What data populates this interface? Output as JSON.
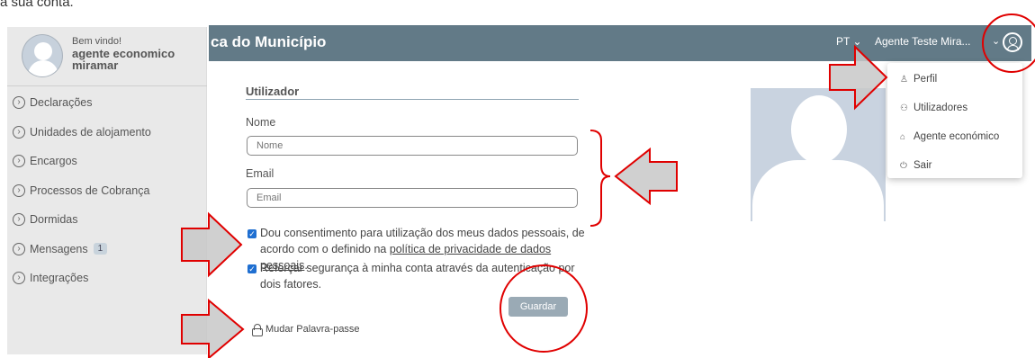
{
  "caption": "a sua conta.",
  "header": {
    "title": "ca do Município",
    "language": "PT",
    "user_label": "Agente Teste Mira..."
  },
  "sidebar": {
    "welcome": "Bem vindo!",
    "user_name": "agente economico miramar",
    "items": [
      {
        "label": "Declarações"
      },
      {
        "label": "Unidades de alojamento"
      },
      {
        "label": "Encargos"
      },
      {
        "label": "Processos de Cobrança"
      },
      {
        "label": "Dormidas"
      },
      {
        "label": "Mensagens",
        "badge": "1"
      },
      {
        "label": "Integrações"
      }
    ]
  },
  "form": {
    "section_title": "Utilizador",
    "name_label": "Nome",
    "name_placeholder": "Nome",
    "email_label": "Email",
    "email_placeholder": "Email",
    "consent_text": "Dou consentimento para utilização dos meus dados pessoais, de acordo com o definido na",
    "consent_link": "política de privacidade de dados pessoais",
    "consent_end": ".",
    "twofactor_text": "Reforçar segurança à minha conta através da autenticação por dois fatores.",
    "save_label": "Guardar",
    "change_password_label": "Mudar Palavra-passe"
  },
  "dropdown": {
    "items": [
      {
        "label": "Perfil",
        "icon": "user-icon"
      },
      {
        "label": "Utilizadores",
        "icon": "users-icon"
      },
      {
        "label": "Agente económico",
        "icon": "home-icon"
      },
      {
        "label": "Sair",
        "icon": "power-icon"
      }
    ]
  },
  "colors": {
    "header": "#627a87",
    "sidebar": "#e9e9e9",
    "annotation_red": "#e00000",
    "arrow_fill": "#c8c8c8",
    "checkbox": "#1f6fd1"
  }
}
